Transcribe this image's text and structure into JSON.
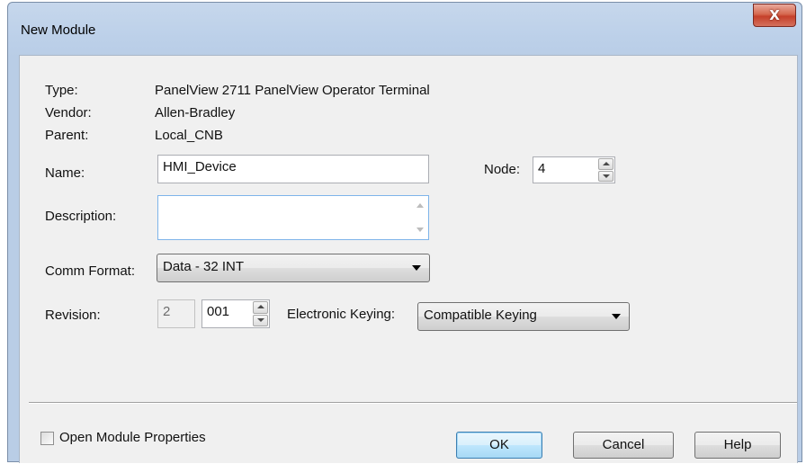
{
  "window": {
    "title": "New Module",
    "close_glyph": "X"
  },
  "fields": {
    "type": {
      "label": "Type:",
      "value": "PanelView 2711 PanelView Operator Terminal"
    },
    "vendor": {
      "label": "Vendor:",
      "value": "Allen-Bradley"
    },
    "parent": {
      "label": "Parent:",
      "value": "Local_CNB"
    },
    "name": {
      "label": "Name:",
      "value": "HMI_Device"
    },
    "node": {
      "label": "Node:",
      "value": "4"
    },
    "description": {
      "label": "Description:",
      "value": ""
    },
    "comm_format": {
      "label": "Comm Format:",
      "selected": "Data - 32 INT"
    },
    "revision": {
      "label": "Revision:",
      "major": "2",
      "minor": "001"
    },
    "electronic_keying": {
      "label": "Electronic Keying:",
      "selected": "Compatible Keying"
    }
  },
  "footer": {
    "open_module_properties": {
      "label": "Open Module Properties",
      "checked": false
    },
    "ok_label": "OK",
    "cancel_label": "Cancel",
    "help_label": "Help"
  },
  "colors": {
    "title_bar": "#bcd0e9",
    "client_bg": "#f0f0f0",
    "close_button": "#c5402a",
    "focus_border": "#7eb4ea"
  },
  "icons": [
    "close-icon",
    "spin-up-icon",
    "spin-down-icon",
    "dropdown-arrow-icon",
    "scroll-up-icon",
    "scroll-down-icon"
  ]
}
